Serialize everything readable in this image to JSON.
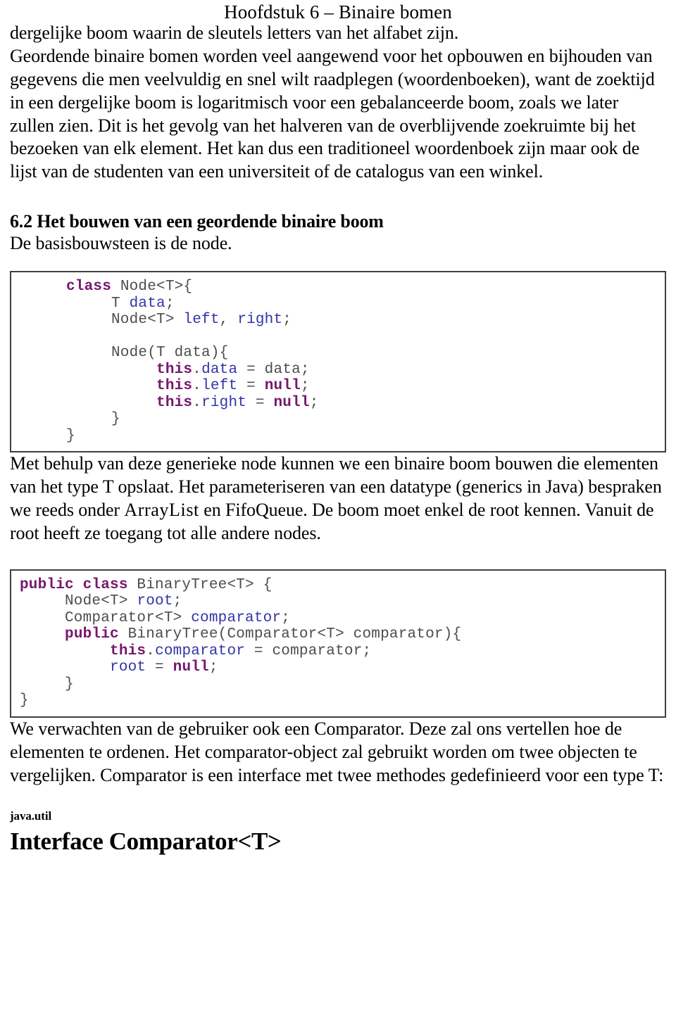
{
  "header": {
    "running_title": "Hoofdstuk 6 – Binaire bomen"
  },
  "content": {
    "lead_line": "dergelijke boom waarin de sleutels letters van het alfabet zijn.",
    "paragraph_1": "Geordende binaire bomen worden veel aangewend voor het opbouwen en bijhouden van gegevens die men veelvuldig en snel wilt raadplegen (woordenboeken), want de zoektijd in een dergelijke boom is logaritmisch voor een gebalanceerde boom, zoals we later zullen zien. Dit is het gevolg van het halveren van de overblijvende zoekruimte bij het bezoeken van elk element. Het kan dus een traditioneel woordenboek zijn maar ook de lijst van de studenten van een universiteit of de catalogus van een winkel.",
    "section_heading": "6.2 Het bouwen van een geordende binaire boom",
    "intro_node": "De basisbouwsteen is de node.",
    "paragraph_2_part1": "Met behulp van deze generieke node kunnen we een binaire boom bouwen die elementen van het type T opslaat. Het parameteriseren van een datatype (generics in Java) bespraken we reeds onder ",
    "paragraph_2_mono1": "ArrayList",
    "paragraph_2_part2": " en FifoQueue. De boom moet enkel de root kennen. Vanuit de root heeft ze toegang tot alle andere nodes.",
    "paragraph_3": "We verwachten van de gebruiker ook een Comparator. Deze zal ons vertellen hoe de elementen te ordenen. Het comparator-object zal gebruikt worden om twee objecten te vergelijken. Comparator is een interface met twee methodes gedefinieerd voor een type T:"
  },
  "code_blocks": {
    "node_class": {
      "language": "java",
      "lines": [
        "class Node<T>{",
        "     T data;",
        "     Node<T> left, right;",
        "",
        "     Node(T data){",
        "          this.data = data;",
        "          this.left = null;",
        "          this.right = null;",
        "     }",
        "}"
      ],
      "keywords": [
        "class",
        "this",
        "null"
      ],
      "identifiers": [
        "data",
        "left",
        "right"
      ]
    },
    "binarytree_class": {
      "language": "java",
      "lines": [
        "public class BinaryTree<T> {",
        "     Node<T> root;",
        "     Comparator<T> comparator;",
        "     public BinaryTree(Comparator<T> comparator){",
        "          this.comparator = comparator;",
        "          root = null;",
        "     }",
        "}"
      ],
      "keywords": [
        "public",
        "class",
        "this",
        "null"
      ],
      "identifiers": [
        "root",
        "comparator"
      ]
    }
  },
  "javadoc": {
    "package": "java.util",
    "interface_title": "Interface Comparator<T>"
  },
  "colors": {
    "keyword": "#76176b",
    "identifier": "#3333aa",
    "code_plain": "#4d4d4d",
    "code_border": "#3f3f3f",
    "text": "#000000",
    "page_background": "#ffffff"
  }
}
